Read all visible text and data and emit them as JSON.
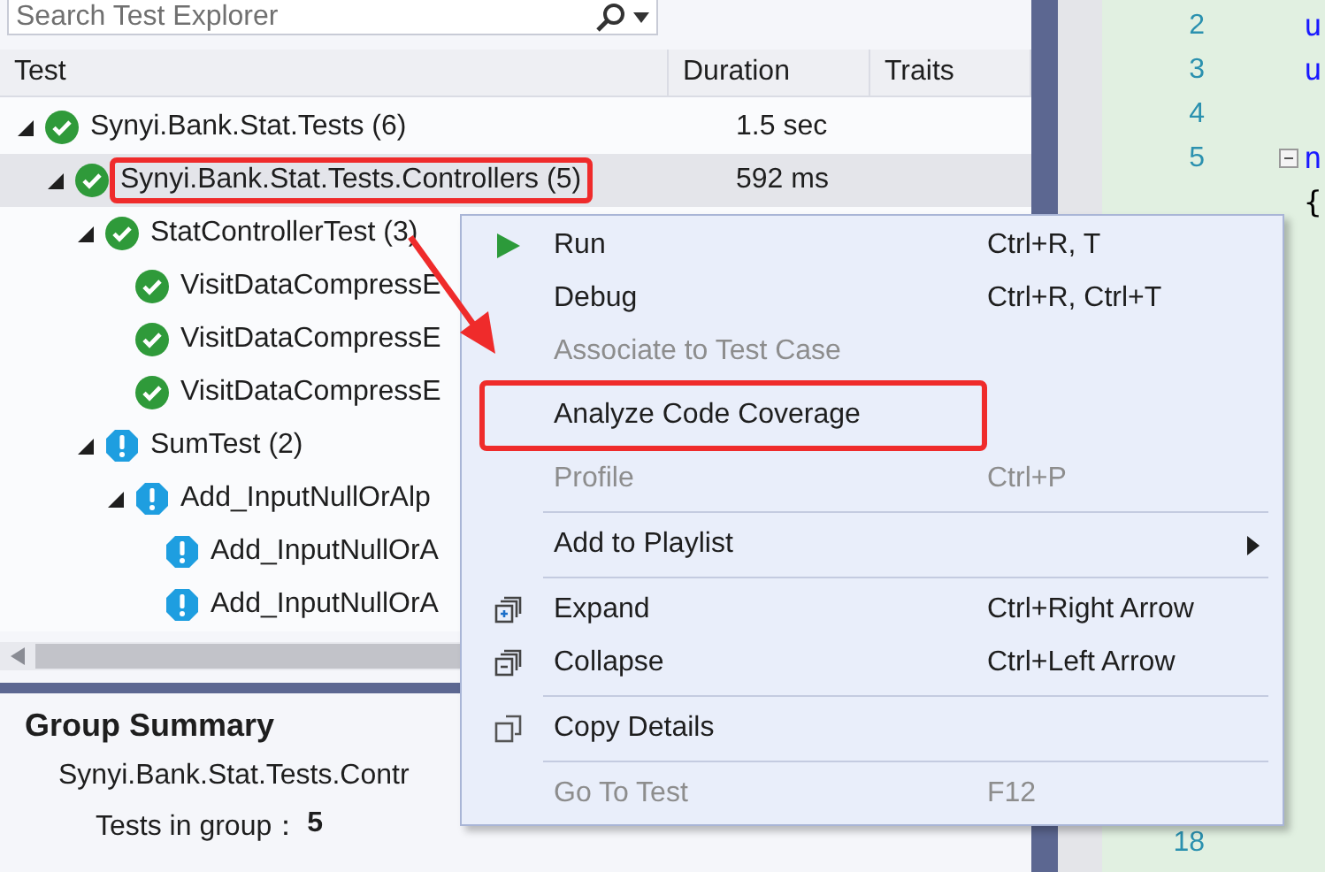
{
  "search": {
    "placeholder": "Search Test Explorer"
  },
  "columns": [
    "Test",
    "Duration",
    "Traits"
  ],
  "tree": [
    {
      "name": "Synyi.Bank.Stat.Tests (6)",
      "kind": "passed",
      "duration": "1.5 sec",
      "expanded": true,
      "selected": false,
      "highlighted": false,
      "children": [
        {
          "name": "Synyi.Bank.Stat.Tests.Controllers (5)",
          "kind": "passed",
          "duration": "592 ms",
          "expanded": true,
          "selected": true,
          "highlighted": true,
          "children": [
            {
              "name": "StatControllerTest (3)",
              "kind": "passed",
              "expanded": true,
              "selected": false,
              "highlighted": false,
              "children": [
                {
                  "name": "VisitDataCompressE",
                  "kind": "passed",
                  "selected": false,
                  "highlighted": false
                },
                {
                  "name": "VisitDataCompressE",
                  "kind": "passed",
                  "selected": false,
                  "highlighted": false
                },
                {
                  "name": "VisitDataCompressE",
                  "kind": "passed",
                  "selected": false,
                  "highlighted": false
                }
              ]
            },
            {
              "name": "SumTest (2)",
              "kind": "notrun",
              "expanded": true,
              "selected": false,
              "highlighted": false,
              "children": [
                {
                  "name": "Add_InputNullOrAlp",
                  "kind": "notrun",
                  "expanded": true,
                  "selected": false,
                  "highlighted": false,
                  "children": [
                    {
                      "name": "Add_InputNullOrA",
                      "kind": "notrun",
                      "selected": false,
                      "highlighted": false
                    },
                    {
                      "name": "Add_InputNullOrA",
                      "kind": "notrun",
                      "selected": false,
                      "highlighted": false
                    }
                  ]
                }
              ]
            }
          ]
        }
      ]
    }
  ],
  "summary": {
    "title": "Group Summary",
    "group": "Synyi.Bank.Stat.Tests.Contr",
    "count_label": "Tests in group：",
    "count": "5"
  },
  "menu": [
    {
      "kind": "run",
      "label": "Run",
      "shortcut": "Ctrl+R, T",
      "disabled": false,
      "highlighted": false
    },
    {
      "kind": "plain",
      "label": "Debug",
      "shortcut": "Ctrl+R, Ctrl+T",
      "disabled": false,
      "highlighted": false
    },
    {
      "kind": "plain",
      "label": "Associate to Test Case",
      "disabled": true,
      "highlighted": false
    },
    {
      "kind": "plain",
      "label": "Analyze Code Coverage",
      "disabled": false,
      "highlighted": true
    },
    {
      "kind": "plain",
      "label": "Profile",
      "shortcut": "Ctrl+P",
      "disabled": true,
      "highlighted": false
    },
    {
      "kind": "separator"
    },
    {
      "kind": "plain",
      "label": "Add to Playlist",
      "submenu": true,
      "disabled": false,
      "highlighted": false
    },
    {
      "kind": "separator"
    },
    {
      "kind": "expand",
      "label": "Expand",
      "shortcut": "Ctrl+Right Arrow",
      "disabled": false,
      "highlighted": false
    },
    {
      "kind": "collapse",
      "label": "Collapse",
      "shortcut": "Ctrl+Left Arrow",
      "disabled": false,
      "highlighted": false
    },
    {
      "kind": "separator"
    },
    {
      "kind": "copy",
      "label": "Copy Details",
      "disabled": false,
      "highlighted": false
    },
    {
      "kind": "separator"
    },
    {
      "kind": "plain",
      "label": "Go To Test",
      "shortcut": "F12",
      "disabled": true,
      "highlighted": false
    }
  ],
  "editor": {
    "lines": [
      {
        "number": "2",
        "code": "u",
        "kind": "keyword"
      },
      {
        "number": "3",
        "code": "u",
        "kind": "keyword"
      },
      {
        "number": "4"
      },
      {
        "number": "5",
        "code": "n",
        "kind": "keyword",
        "fold": true
      },
      {
        "code": "{",
        "kind": "plain"
      }
    ],
    "bottom_line": {
      "number": "18"
    }
  }
}
